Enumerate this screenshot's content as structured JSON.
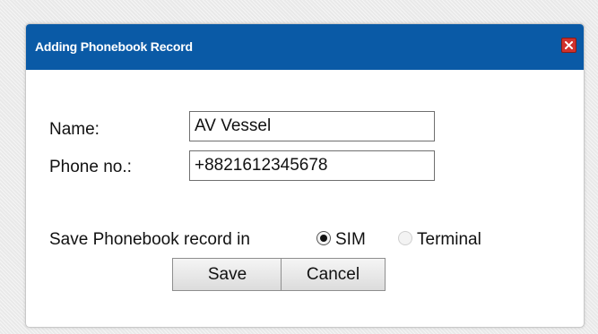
{
  "dialog": {
    "title": "Adding Phonebook Record",
    "close_icon": "close-icon"
  },
  "form": {
    "name_label": "Name:",
    "name_value": "AV Vessel",
    "phone_label": "Phone no.:",
    "phone_value": "+8821612345678",
    "save_in_label": "Save Phonebook record in",
    "options": [
      {
        "label": "SIM",
        "selected": true
      },
      {
        "label": "Terminal",
        "selected": false
      }
    ]
  },
  "buttons": {
    "save_label": "Save",
    "cancel_label": "Cancel"
  },
  "colors": {
    "titlebar": "#0a5aa6",
    "close_button": "#d0322d"
  }
}
